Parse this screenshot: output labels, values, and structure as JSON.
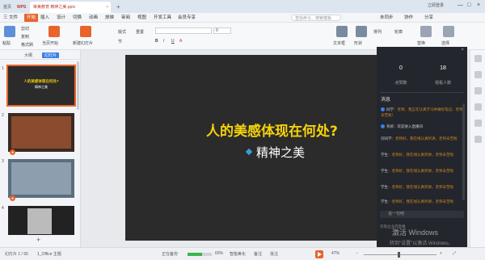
{
  "titlebar": {
    "home_tab": "首页",
    "wps_tab": "WPS",
    "doc_tab": "审美教育 精神之美.pptx",
    "add_tab": "+",
    "login": "立即登录"
  },
  "menu": {
    "items": [
      "三 文件",
      "开始",
      "插入",
      "设计",
      "切换",
      "动画",
      "放映",
      "审阅",
      "视图",
      "开发工具",
      "会员专享"
    ],
    "search_placeholder": "查找命令、搜索模板",
    "right_items": [
      "未同步",
      "协作",
      "分享"
    ]
  },
  "ribbon": {
    "paste": "粘贴",
    "cut": "剪切",
    "copy": "复制",
    "format_painter": "格式刷",
    "start_from_current": "当页开始",
    "new_slide": "新建幻灯片",
    "layout": "版式",
    "section": "节",
    "reset": "重置",
    "font_name": "",
    "font_size": "0",
    "textbox": "文本框",
    "shape": "形状",
    "arrange": "排列",
    "outline": "轮廓",
    "replace": "替换",
    "select": "选择"
  },
  "left_panel": {
    "tab_outline": "大纲",
    "tab_slides": "幻灯片",
    "thumb1_title": "人的美感体现在何处?",
    "thumb1_sub": "精神之美",
    "nums": [
      "1",
      "2",
      "3",
      "4"
    ]
  },
  "slide": {
    "title": "人的美感体现在何处?",
    "subtitle": "精神之美"
  },
  "live_panel": {
    "stat1_value": "0",
    "stat1_label": "点赞数",
    "stat2_value": "18",
    "stat2_label": "观看人数",
    "section_title": "消息",
    "chats": [
      {
        "who": "同学",
        "text": "老师，我正在认真学习并做好笔记，老师辛苦啦！"
      },
      {
        "who": "系统",
        "text": "欢迎进入直播间"
      },
      {
        "who": "刘同学",
        "text": "老师好，我在线认真听讲，老师辛苦啦"
      },
      {
        "who": "学生",
        "text": "老师好，我在线认真听讲，老师辛苦啦"
      },
      {
        "who": "学生",
        "text": "老师好，我在线认真听讲，老师辛苦啦"
      },
      {
        "who": "学生",
        "text": "老师好，我在线认真听讲，老师辛苦啦"
      },
      {
        "who": "学生",
        "text": "老师好，我在线认真听讲，老师辛苦啦"
      }
    ],
    "input_placeholder": "说一句吧",
    "footer": "仅限企业内直播",
    "watermark_title": "激活 Windows",
    "watermark_sub": "转到\"设置\"以激活 Windows。"
  },
  "status": {
    "slide_counter": "幻灯片 1 / 56",
    "theme": "1_Office 主题",
    "backup": "正在备份",
    "progress_percent": 60,
    "progress_text": "60%",
    "smart": "智能美化",
    "notes": "备注",
    "comments": "批注",
    "zoom": "47%"
  },
  "colors": {
    "accent": "#e8642c",
    "slide_bg": "#2b2b2b",
    "slide_title": "#f5d20b",
    "live_bg": "#23262c",
    "chat_text": "#d48a1c"
  }
}
